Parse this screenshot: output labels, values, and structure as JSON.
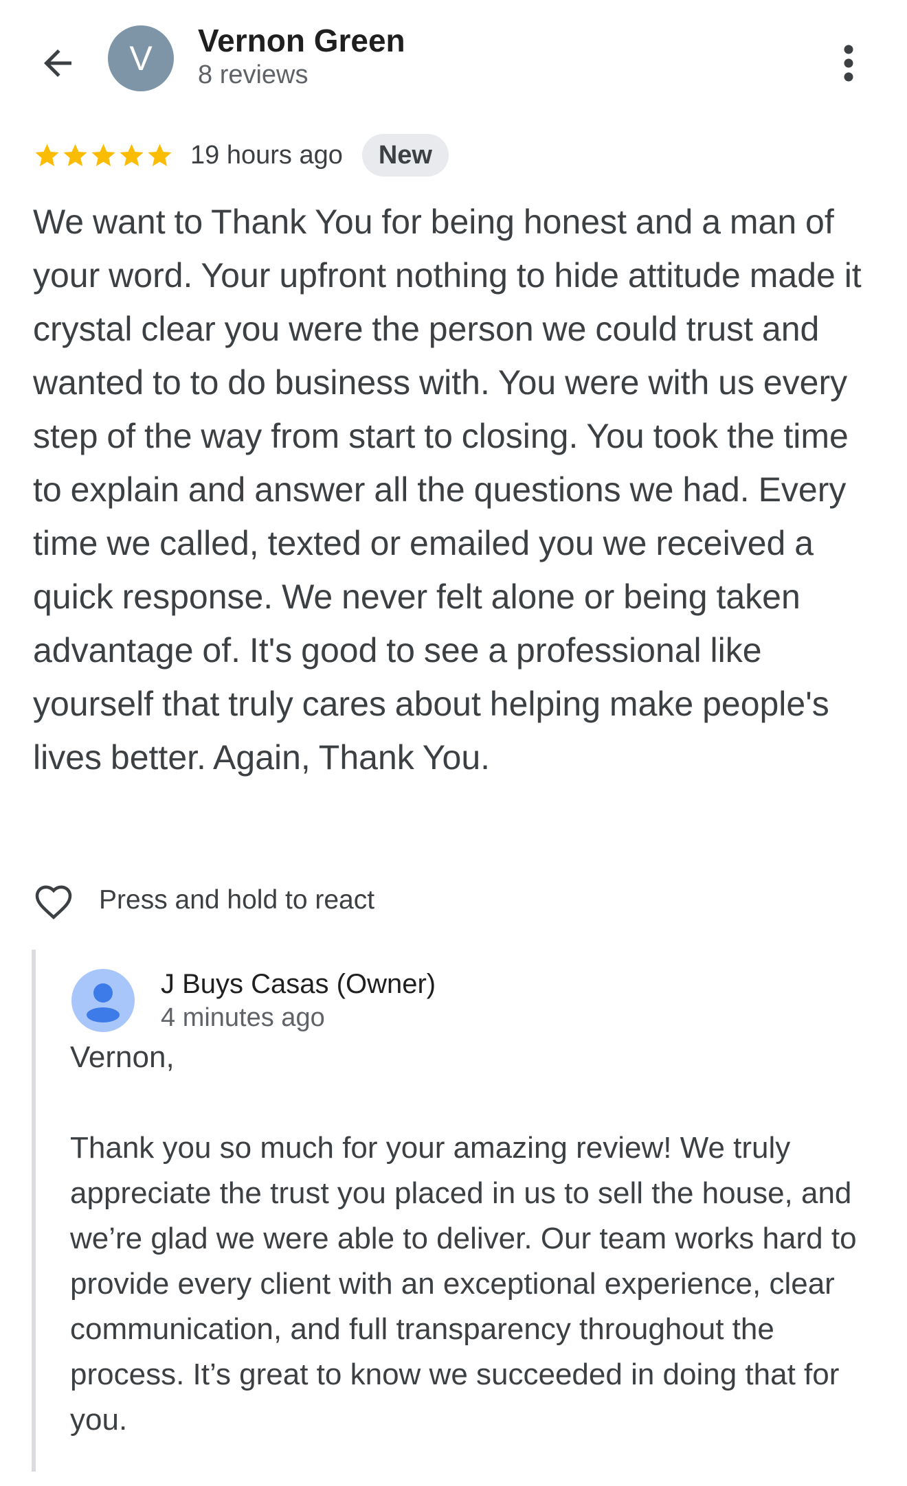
{
  "header": {
    "reviewer_initial": "V",
    "reviewer_name": "Vernon Green",
    "reviewer_meta": "8 reviews",
    "avatar_color": "#7d95a6"
  },
  "icons": {
    "back": "arrow-back-icon",
    "more": "more-vert-icon",
    "star": "star-icon",
    "heart": "heart-outline-icon",
    "owner_avatar": "person-icon"
  },
  "review": {
    "rating": 5,
    "rating_max": 5,
    "star_color": "#fbbc04",
    "time": "19 hours ago",
    "badge": "New",
    "text": "We want to Thank You for being honest and a man of your word. Your upfront nothing to hide attitude made it crystal clear you were the person we could trust and wanted to to do business with. You were with us every step of the way from start to closing. You took the time to explain and answer all the questions we had. Every time we called, texted or emailed you we received a quick response. We never felt alone or being taken advantage of. It's good to see a professional like yourself that truly cares about helping make people's lives better. Again, Thank You."
  },
  "react": {
    "label": "Press and hold to react"
  },
  "owner_reply": {
    "name": "J Buys Casas (Owner)",
    "time": "4 minutes ago",
    "greeting": "Vernon,",
    "body": "Thank you so much for your amazing review! We truly appreciate the trust you placed in us to sell the house, and we’re glad we were able to deliver. Our team works hard to provide every client with an exceptional experience, clear communication, and full transparency throughout the process. It’s great to know we succeeded in doing that for you."
  }
}
